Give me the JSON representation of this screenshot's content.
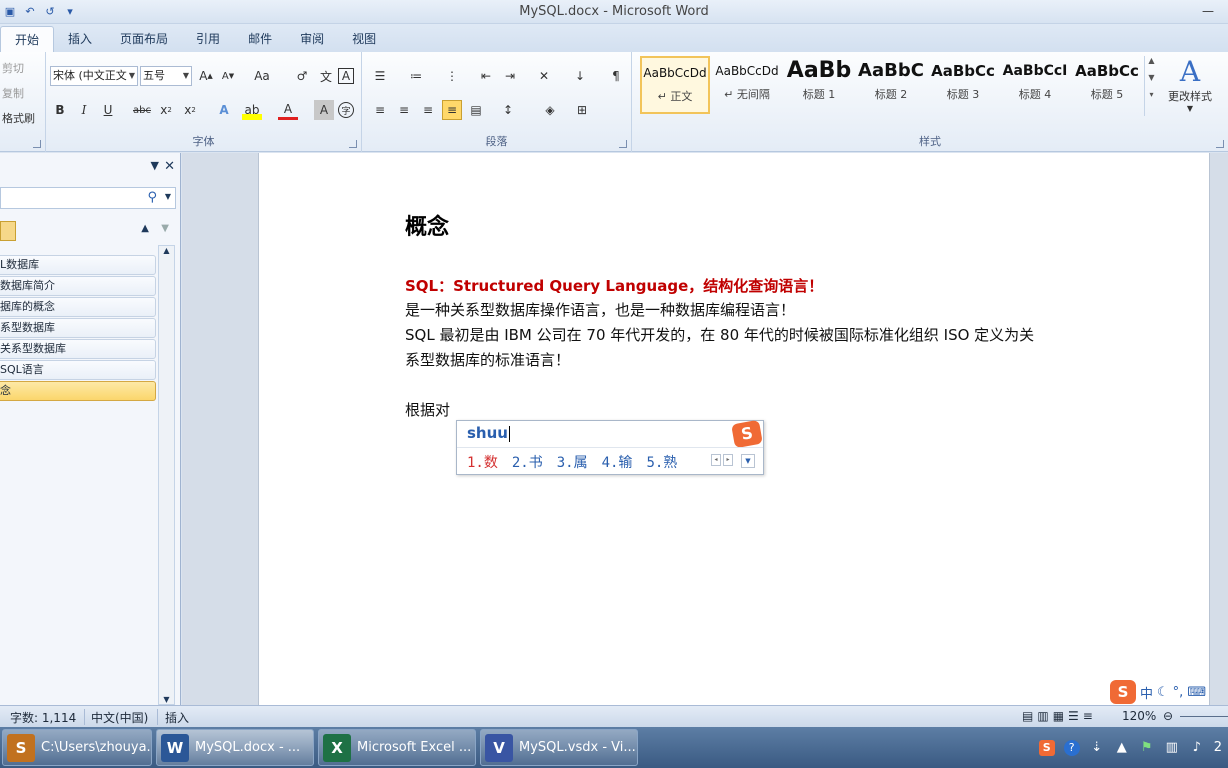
{
  "window": {
    "title": "MySQL.docx - Microsoft Word",
    "controls": [
      "—"
    ]
  },
  "tabs": [
    "开始",
    "插入",
    "页面布局",
    "引用",
    "邮件",
    "审阅",
    "视图"
  ],
  "clipboard": {
    "cut": "剪切",
    "copy": "复制",
    "format_painter": "格式刷"
  },
  "font": {
    "name": "宋体 (中文正文",
    "size": "五号",
    "label": "字体"
  },
  "paragraph": {
    "label": "段落"
  },
  "styles": {
    "label": "样式",
    "items": [
      {
        "sample": "AaBbCcDd",
        "name": "↵ 正文"
      },
      {
        "sample": "AaBbCcDd",
        "name": "↵ 无间隔"
      },
      {
        "sample": "AaBb",
        "name": "标题 1"
      },
      {
        "sample": "AaBbC",
        "name": "标题 2"
      },
      {
        "sample": "AaBbCc",
        "name": "标题 3"
      },
      {
        "sample": "AaBbCcI",
        "name": "标题 4"
      },
      {
        "sample": "AaBbCc",
        "name": "标题 5"
      }
    ],
    "change": "更改样式"
  },
  "nav": {
    "items": [
      "L数据库",
      "数据库简介",
      "据库的概念",
      "系型数据库",
      "关系型数据库",
      "SQL语言",
      "念"
    ]
  },
  "document": {
    "heading": "概念",
    "red_line": "SQL：Structured Query Language，结构化查询语言！",
    "line1": "是一种关系型数据库操作语言，也是一种数据库编程语言！",
    "line2": "SQL 最初是由 IBM 公司在 70 年代开发的，在 80 年代的时候被国际标准化组织 ISO 定义为关",
    "line3": "系型数据库的标准语言！",
    "line4": "根据对"
  },
  "ime": {
    "input": "shuu",
    "candidates": [
      "1.数",
      "2.书",
      "3.属",
      "4.输",
      "5.熟"
    ],
    "logo": "S"
  },
  "sogou_bar": {
    "lang": "中"
  },
  "status": {
    "word_count": "字数: 1,114",
    "language": "中文(中国)",
    "mode": "插入",
    "zoom": "120%"
  },
  "taskbar": {
    "items": [
      {
        "icon": "S",
        "label": "C:\\Users\\zhouya...",
        "color": "#c1711f"
      },
      {
        "icon": "W",
        "label": "MySQL.docx - ...",
        "color": "#2b5797"
      },
      {
        "icon": "X",
        "label": "Microsoft Excel ...",
        "color": "#1e7145"
      },
      {
        "icon": "V",
        "label": "MySQL.vsdx - Vi...",
        "color": "#3955a3"
      }
    ],
    "clock": "2"
  },
  "colors": {
    "ribbon_bg": "#e4ecf6",
    "red_text": "#c00000",
    "highlight": "#fbd66c",
    "taskbar": "#3a5a82"
  }
}
